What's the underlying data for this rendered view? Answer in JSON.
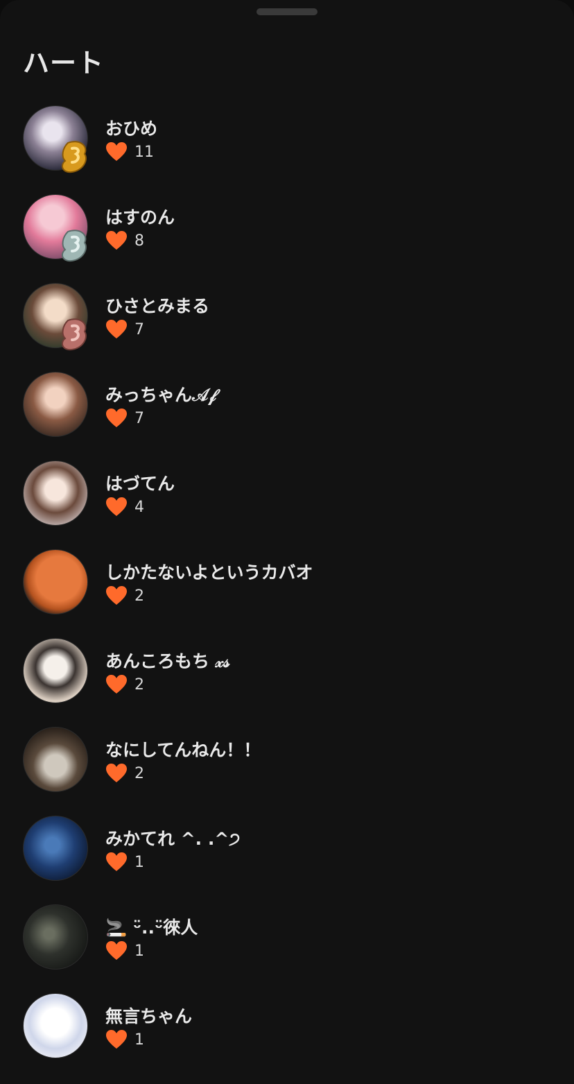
{
  "header": {
    "title": "ハート"
  },
  "icons": {
    "heart": "heart-icon",
    "heart_color": "#ff6a2b"
  },
  "users": [
    {
      "name": "おひめ",
      "count": "11",
      "badge": "gold"
    },
    {
      "name": "はすのん",
      "count": "8",
      "badge": "silver"
    },
    {
      "name": "ひさとみまる",
      "count": "7",
      "badge": "bronze"
    },
    {
      "name": "みっちゃん𝒜𝒻",
      "count": "7",
      "badge": ""
    },
    {
      "name": "はづてん",
      "count": "4",
      "badge": ""
    },
    {
      "name": "しかたないよというカバオ",
      "count": "2",
      "badge": ""
    },
    {
      "name": "あんころもち 𝓍𝓈",
      "count": "2",
      "badge": ""
    },
    {
      "name": "なにしてんねん！！",
      "count": "2",
      "badge": ""
    },
    {
      "name": "みかてれ ^. .^੭",
      "count": "1",
      "badge": ""
    },
    {
      "name": "🚬 ᵕ̈..ᵕ̈徠人",
      "count": "1",
      "badge": ""
    },
    {
      "name": "無言ちゃん",
      "count": "1",
      "badge": ""
    }
  ]
}
